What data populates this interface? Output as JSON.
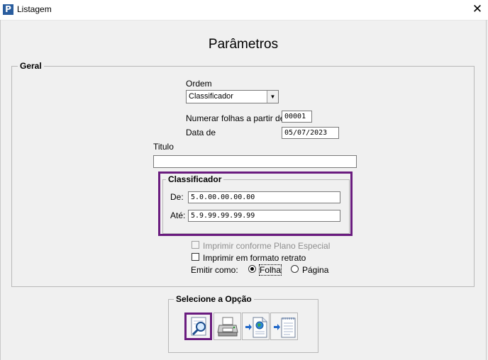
{
  "window": {
    "title": "Listagem",
    "app_icon": "P"
  },
  "header": {
    "title": "Parâmetros"
  },
  "geral": {
    "legend": "Geral",
    "ordem_label": "Ordem",
    "ordem_value": "Classificador",
    "numerar_label": "Numerar folhas a partir de:",
    "numerar_value": "00001",
    "data_label": "Data de",
    "data_value": "05/07/2023",
    "titulo_label": "Titulo",
    "titulo_value": ""
  },
  "classificador": {
    "legend": "Classificador",
    "de_label": "De:",
    "de_value": "5.0.00.00.00.00",
    "ate_label": "Até:",
    "ate_value": "5.9.99.99.99.99"
  },
  "options": {
    "plano_especial": {
      "label": "Imprimir conforme Plano Especial",
      "checked": false,
      "disabled": true
    },
    "retrato": {
      "label": "Imprimir em formato retrato",
      "checked": false
    },
    "emitir_label": "Emitir como:",
    "folha_label": "Folha",
    "pagina_label": "Página",
    "selected": "Folha"
  },
  "selecione": {
    "legend": "Selecione a Opção",
    "buttons": [
      {
        "name": "preview-icon",
        "selected": true
      },
      {
        "name": "printer-icon",
        "selected": false
      },
      {
        "name": "export-web-icon",
        "selected": false
      },
      {
        "name": "export-document-icon",
        "selected": false
      }
    ]
  },
  "colors": {
    "highlight": "#6a1c7f",
    "background": "#f0f0f0",
    "app_icon": "#2a5d9e"
  }
}
